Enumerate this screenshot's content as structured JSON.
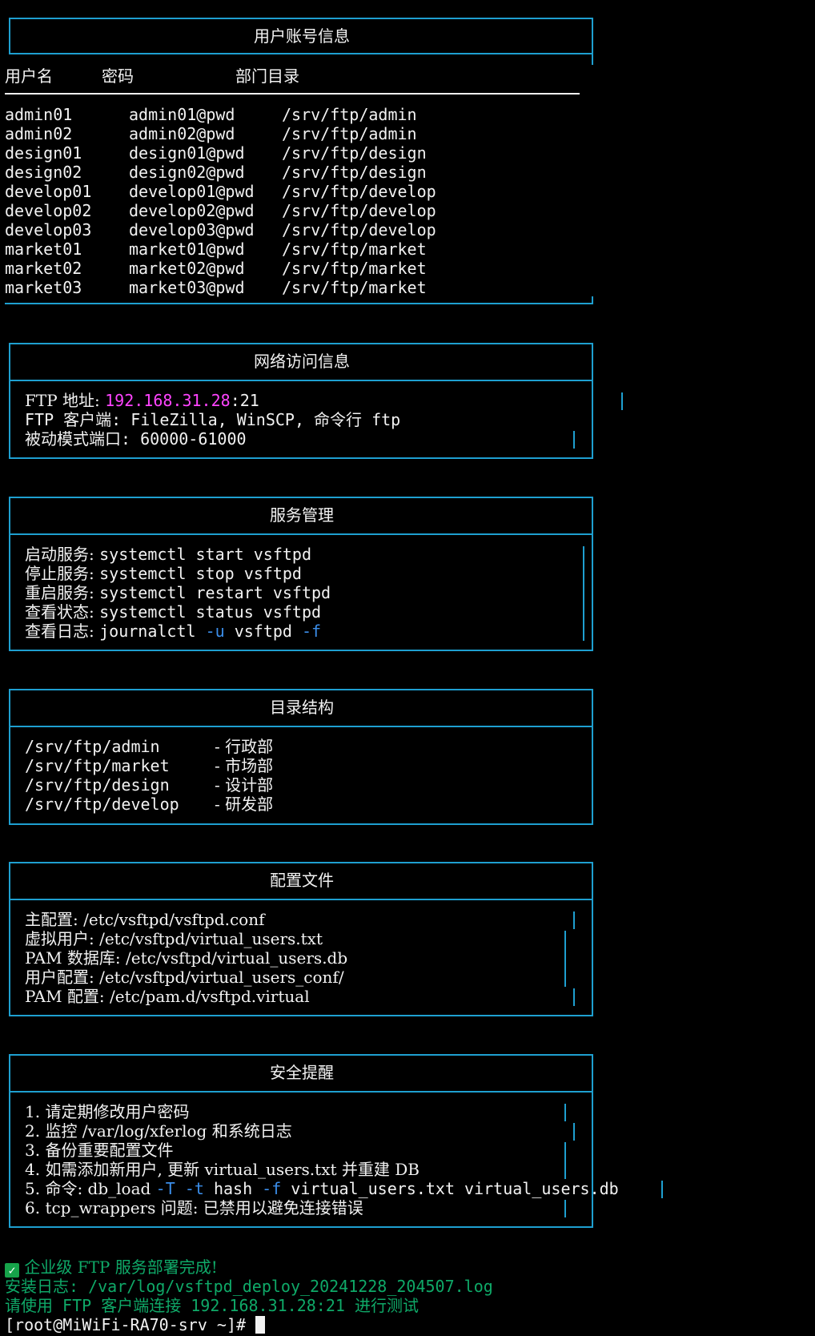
{
  "accounts": {
    "title": "用户账号信息",
    "headers": [
      "用户名",
      "密码",
      "部门目录"
    ],
    "rows": [
      [
        "admin01",
        "admin01@pwd",
        "/srv/ftp/admin"
      ],
      [
        "admin02",
        "admin02@pwd",
        "/srv/ftp/admin"
      ],
      [
        "design01",
        "design01@pwd",
        "/srv/ftp/design"
      ],
      [
        "design02",
        "design02@pwd",
        "/srv/ftp/design"
      ],
      [
        "develop01",
        "develop01@pwd",
        "/srv/ftp/develop"
      ],
      [
        "develop02",
        "develop02@pwd",
        "/srv/ftp/develop"
      ],
      [
        "develop03",
        "develop03@pwd",
        "/srv/ftp/develop"
      ],
      [
        "market01",
        "market01@pwd",
        "/srv/ftp/market"
      ],
      [
        "market02",
        "market02@pwd",
        "/srv/ftp/market"
      ],
      [
        "market03",
        "market03@pwd",
        "/srv/ftp/market"
      ]
    ]
  },
  "network": {
    "title": "网络访问信息",
    "ftp_label": "FTP 地址: ",
    "ip": "192.168.31.28",
    "port": ":21",
    "client_line": "FTP 客户端: FileZilla, WinSCP, 命令行 ftp",
    "passive_line": "被动模式端口: 60000-61000"
  },
  "service": {
    "title": "服务管理",
    "lines": [
      {
        "label": "启动服务: ",
        "cmd": "systemctl start vsftpd"
      },
      {
        "label": "停止服务: ",
        "cmd": "systemctl stop vsftpd"
      },
      {
        "label": "重启服务: ",
        "cmd": "systemctl restart vsftpd"
      },
      {
        "label": "查看状态: ",
        "cmd": "systemctl status vsftpd"
      }
    ],
    "log_label": "查看日志: ",
    "log_cmd": "journalctl",
    "log_flag_u": "-u",
    "log_service": "vsftpd",
    "log_flag_f": "-f"
  },
  "dirs": {
    "title": "目录结构",
    "rows": [
      {
        "path": "/srv/ftp/admin",
        "dept": "- 行政部"
      },
      {
        "path": "/srv/ftp/market",
        "dept": "- 市场部"
      },
      {
        "path": "/srv/ftp/design",
        "dept": "- 设计部"
      },
      {
        "path": "/srv/ftp/develop",
        "dept": "- 研发部"
      }
    ]
  },
  "config": {
    "title": "配置文件",
    "lines": [
      "主配置: /etc/vsftpd/vsftpd.conf",
      "虚拟用户: /etc/vsftpd/virtual_users.txt",
      "PAM 数据库: /etc/vsftpd/virtual_users.db",
      "用户配置: /etc/vsftpd/virtual_users_conf/",
      "PAM 配置: /etc/pam.d/vsftpd.virtual"
    ]
  },
  "security": {
    "title": "安全提醒",
    "lines": [
      "1. 请定期修改用户密码",
      "2. 监控 /var/log/xferlog 和系统日志",
      "3. 备份重要配置文件",
      "4. 如需添加新用户, 更新 virtual_users.txt 并重建 DB"
    ],
    "line5_prefix": "5. 命令: db_load ",
    "line5_T": "-T",
    "line5_t": "-t",
    "line5_hash": " hash ",
    "line5_f": "-f",
    "line5_rest": " virtual_users.txt virtual_users.db",
    "line6": "6. tcp_wrappers 问题: 已禁用以避免连接错误"
  },
  "footer": {
    "done_icon": "check-box-icon",
    "done_text": " 企业级 FTP 服务部署完成!",
    "log_line": "安装日志: /var/log/vsftpd_deploy_20241228_204507.log",
    "test_line": "请使用 FTP 客户端连接 192.168.31.28:21 进行测试",
    "prompt": "[root@MiWiFi-RA70-srv ~]# "
  },
  "colors": {
    "border": "#1e9fd0",
    "ip": "#ff44ff",
    "flag": "#3b8eea",
    "success": "#0fa968"
  }
}
